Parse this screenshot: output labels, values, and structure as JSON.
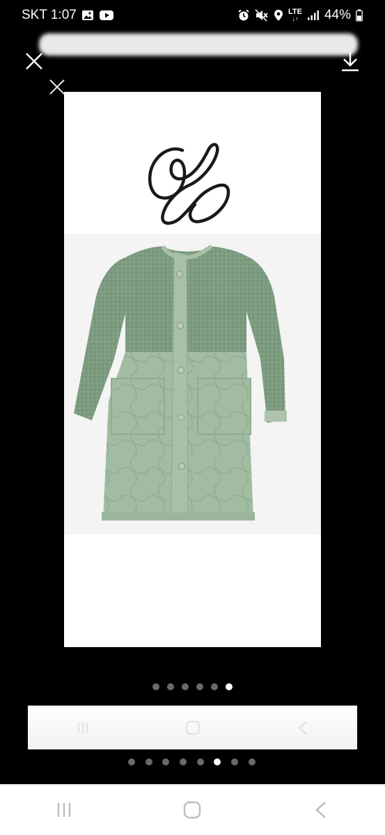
{
  "status_bar": {
    "carrier_time": "SKT 1:07",
    "network": "LTE",
    "battery": "44%",
    "left_icons": [
      "gallery-icon",
      "youtube-icon"
    ],
    "right_icons": [
      "alarm-icon",
      "mute-icon",
      "location-icon",
      "lte-icon",
      "signal-icon",
      "battery-icon"
    ]
  },
  "viewer": {
    "actions": [
      "close-icon",
      "download-icon",
      "close-icon"
    ],
    "image": {
      "subject": "sage green long quilted coat with fleece yoke",
      "overlay": "handwritten scribble mark",
      "colors": {
        "fleece": "#7d9c80",
        "quilted": "#a2bca2",
        "background": "#f3f4f3"
      }
    }
  },
  "pagination_inner": {
    "count": 6,
    "active_index": 5
  },
  "pagination_outer": {
    "count": 8,
    "active_index": 5
  },
  "navigation": {
    "buttons": [
      "recent-apps-icon",
      "home-icon",
      "back-icon"
    ]
  },
  "colors": {
    "background": "#000000",
    "dot_inactive": "#6a6a6a",
    "dot_active": "#ffffff"
  }
}
